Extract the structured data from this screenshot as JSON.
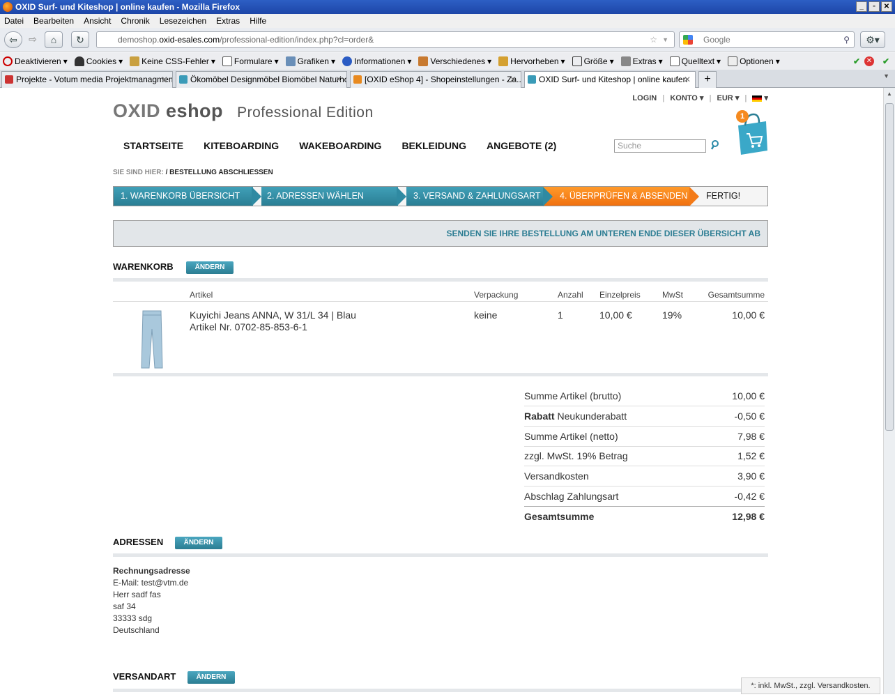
{
  "window": {
    "title": "OXID Surf- und Kiteshop | online kaufen - Mozilla Firefox"
  },
  "menu": [
    "Datei",
    "Bearbeiten",
    "Ansicht",
    "Chronik",
    "Lesezeichen",
    "Extras",
    "Hilfe"
  ],
  "urlbar": {
    "domain_prefix": "demoshop.",
    "domain": "oxid-esales.com",
    "path": "/professional-edition/index.php?cl=order&"
  },
  "searchbar": {
    "placeholder": "Google"
  },
  "webdev": [
    "Deaktivieren",
    "Cookies",
    "Keine CSS-Fehler",
    "Formulare",
    "Grafiken",
    "Informationen",
    "Verschiedenes",
    "Hervorheben",
    "Größe",
    "Extras",
    "Quelltext",
    "Optionen"
  ],
  "tabs": [
    {
      "label": "Projekte - Votum media Projektmanagment"
    },
    {
      "label": "Ökomöbel Designmöbel Biomöbel Naturho..."
    },
    {
      "label": "[OXID eShop 4] - Shopeinstellungen - Za..."
    },
    {
      "label": "OXID Surf- und Kiteshop | online kaufen"
    }
  ],
  "shop": {
    "topnav": {
      "login": "LOGIN",
      "account": "KONTO",
      "currency": "EUR"
    },
    "logo": {
      "oxid": "OXID",
      "eshop": "eshop",
      "edition": "Professional Edition"
    },
    "nav": [
      "STARTSEITE",
      "KITEBOARDING",
      "WAKEBOARDING",
      "BEKLEIDUNG",
      "ANGEBOTE (2)"
    ],
    "search_placeholder": "Suche",
    "cart_count": "1",
    "breadcrumb": {
      "label": "SIE SIND HIER:",
      "sep": " / ",
      "current": "BESTELLUNG ABSCHLIESSEN"
    },
    "steps": [
      "1. WARENKORB ÜBERSICHT",
      "2. ADRESSEN WÄHLEN",
      "3. VERSAND & ZAHLUNGSART",
      "4. ÜBERPRÜFEN & ABSENDEN",
      "FERTIG!"
    ],
    "notice": "SENDEN SIE IHRE BESTELLUNG AM UNTEREN ENDE DIESER ÜBERSICHT AB",
    "basket": {
      "heading": "WARENKORB",
      "edit": "ÄNDERN",
      "columns": [
        "Artikel",
        "Verpackung",
        "Anzahl",
        "Einzelpreis",
        "MwSt",
        "Gesamtsumme"
      ],
      "item": {
        "name": "Kuyichi Jeans ANNA, W 31/L 34 | Blau",
        "number": "Artikel Nr. 0702-85-853-6-1",
        "packaging": "keine",
        "qty": "1",
        "unit_price": "10,00 €",
        "vat": "19%",
        "total": "10,00 €"
      }
    },
    "summary": [
      {
        "label": "Summe Artikel (brutto)",
        "value": "10,00 €"
      },
      {
        "label_bold": "Rabatt",
        "label": "Neukunderabatt",
        "value": "-0,50 €"
      },
      {
        "label": "Summe Artikel (netto)",
        "value": "7,98 €"
      },
      {
        "label": "zzgl. MwSt. 19% Betrag",
        "value": "1,52 €"
      },
      {
        "label": "Versandkosten",
        "value": "3,90 €"
      },
      {
        "label": "Abschlag Zahlungsart",
        "value": "-0,42 €"
      },
      {
        "label": "Gesamtsumme",
        "value": "12,98 €"
      }
    ],
    "addresses": {
      "heading": "ADRESSEN",
      "edit": "ÄNDERN",
      "billing_title": "Rechnungsadresse",
      "lines": [
        "E-Mail: test@vtm.de",
        "Herr sadf fas",
        "saf 34",
        "33333 sdg",
        "Deutschland"
      ]
    },
    "shipping": {
      "heading": "VERSANDART",
      "edit": "ÄNDERN"
    },
    "footnote": "*: inkl. MwSt., zzgl. Versandkosten."
  },
  "colors": {
    "teal": "#2a7e94",
    "orange": "#f07010",
    "notice_text": "#2c7d93"
  }
}
